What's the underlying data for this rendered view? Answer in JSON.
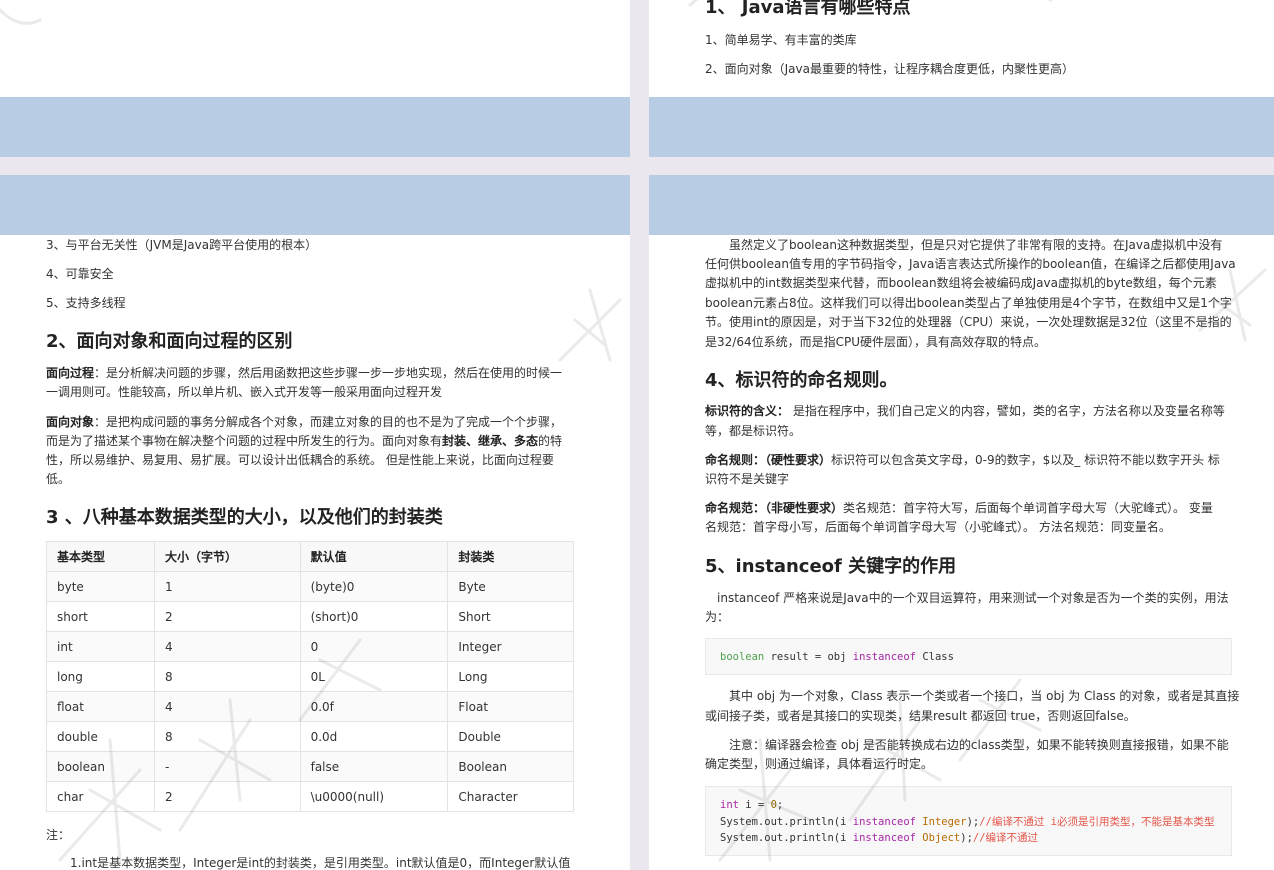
{
  "left_top": {},
  "right_top": {
    "heading": "1、 Java语言有哪些特点",
    "item1": "1、简单易学、有丰富的类库",
    "item2": "2、面向对象（Java最重要的特性，让程序耦合度更低，内聚性更高）"
  },
  "left_bottom": {
    "item3": "3、与平台无关性（JVM是Java跨平台使用的根本）",
    "item4": "4、可靠安全",
    "item5": "5、支持多线程",
    "h2_oop": "2、面向对象和面向过程的区别",
    "proc_label": "面向过程",
    "proc_text_1": "：是分析解决问题的步骤，然后用函数把这些步骤一步一步地实现，然后在使用的时候一",
    "proc_text_2": "一调用则可。性能较高，所以单片机、嵌入式开发等一般采用面向过程开发",
    "obj_label": "面向对象",
    "obj_text_1": "：是把构成问题的事务分解成各个对象，而建立对象的目的也不是为了完成一个个步骤，",
    "obj_text_2a": "而是为了描述某个事物在解决整个问题的过程中所发生的行为。面向对象有",
    "obj_kw": "封装、继承、多态",
    "obj_text_2b": "的特",
    "obj_text_3": "性，所以易维护、易复用、易扩展。可以设计出低耦合的系统。 但是性能上来说，比面向过程要",
    "obj_text_4": "低。",
    "h2_types": "3 、八种基本数据类型的大小，以及他们的封装类",
    "table_headers": [
      "基本类型",
      "大小（字节）",
      "默认值",
      "封装类"
    ],
    "table_rows": [
      [
        "byte",
        "1",
        "(byte)0",
        "Byte"
      ],
      [
        "short",
        "2",
        "(short)0",
        "Short"
      ],
      [
        "int",
        "4",
        "0",
        "Integer"
      ],
      [
        "long",
        "8",
        "0L",
        "Long"
      ],
      [
        "float",
        "4",
        "0.0f",
        "Float"
      ],
      [
        "double",
        "8",
        "0.0d",
        "Double"
      ],
      [
        "boolean",
        "-",
        "false",
        "Boolean"
      ],
      [
        "char",
        "2",
        "\\u0000(null)",
        "Character"
      ]
    ],
    "note_label": "注：",
    "note_1": "1.int是基本数据类型，Integer是int的封装类，是引用类型。int默认值是0，而Integer默认值"
  },
  "right_bottom": {
    "bool_p1": "虽然定义了boolean这种数据类型，但是只对它提供了非常有限的支持。在Java虚拟机中没有",
    "bool_p2": "任何供boolean值专用的字节码指令，Java语言表达式所操作的boolean值，在编译之后都使用Java",
    "bool_p3": "虚拟机中的int数据类型来代替，而boolean数组将会被编码成Java虚拟机的byte数组，每个元素",
    "bool_p4": "boolean元素占8位。这样我们可以得出boolean类型占了单独使用是4个字节，在数组中又是1个字",
    "bool_p5": "节。使用int的原因是，对于当下32位的处理器（CPU）来说，一次处理数据是32位（这里不是指的",
    "bool_p6": "是32/64位系统，而是指CPU硬件层面），具有高效存取的特点。",
    "h2_ident": "4、标识符的命名规则。",
    "ident_label": "标识符的含义：",
    "ident_text_1": " 是指在程序中，我们自己定义的内容，譬如，类的名字，方法名称以及变量名称等",
    "ident_text_2": "等，都是标识符。",
    "rule_label": "命名规则：（硬性要求）",
    "rule_text_1": "标识符可以包含英文字母，0-9的数字，$以及_ 标识符不能以数字开头 标",
    "rule_text_2": "识符不是关键字",
    "spec_label": "命名规范：（非硬性要求）",
    "spec_text_1": "类名规范：首字符大写，后面每个单词首字母大写（大驼峰式）。 变量",
    "spec_text_2": "名规范：首字母小写，后面每个单词首字母大写（小驼峰式）。 方法名规范：同变量名。",
    "h2_instanceof": "5、instanceof 关键字的作用",
    "inst_text_1": "instanceof 严格来说是Java中的一个双目运算符，用来测试一个对象是否为一个类的实例，用法",
    "inst_text_2": "为：",
    "code1": {
      "kw": "boolean",
      "mid": " result = obj ",
      "op": "instanceof",
      "cls": " Class"
    },
    "inst_p1": "其中 obj 为一个对象，Class 表示一个类或者一个接口，当 obj 为 Class 的对象，或者是其直接",
    "inst_p2": "或间接子类，或者是其接口的实现类，结果result 都返回 true，否则返回false。",
    "inst_n1": "注意：编译器会检查 obj 是否能转换成右边的class类型，如果不能转换则直接报错，如果不能",
    "inst_n2": "确定类型，则通过编译，具体看运行时定。",
    "code2": {
      "l1_kw": "int",
      "l1_rest": " i = ",
      "l1_num": "0",
      "l1_end": ";",
      "l2_a": "System.out.println(i ",
      "l2_op": "instanceof",
      "l2_cls": " Integer",
      "l2_b": ");",
      "l2_cmt": "//编译不通过  i必须是引用类型，不能是基本类型",
      "l3_a": "System.out.println(i ",
      "l3_op": "instanceof",
      "l3_cls": " Object",
      "l3_b": ");",
      "l3_cmt": "//编译不通过"
    }
  },
  "colors": {
    "band": "#b8cce4",
    "gutter": "#ebe7ee"
  }
}
